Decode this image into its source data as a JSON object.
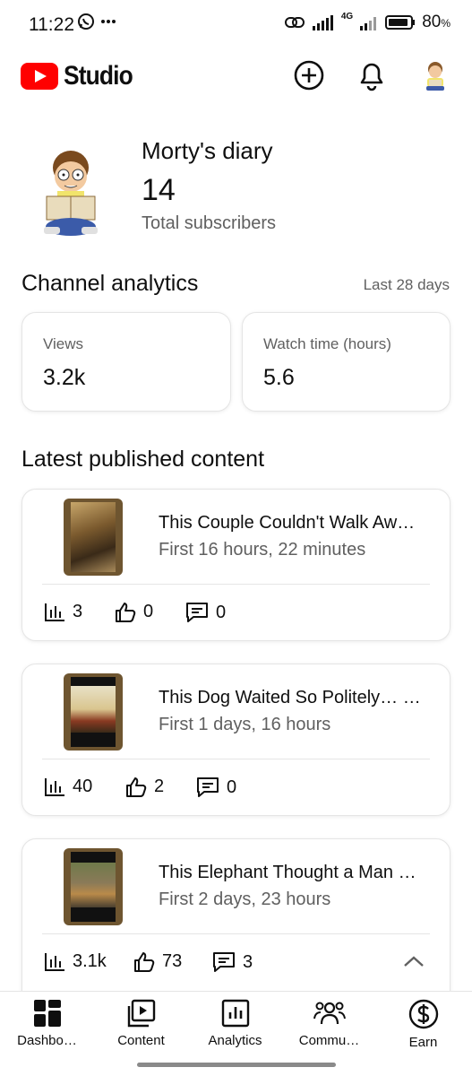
{
  "status_bar": {
    "time": "11:22",
    "network": "4G",
    "battery": "80",
    "battery_unit": "%"
  },
  "header": {
    "logo_text": "Studio",
    "brand_color": "#ff0000",
    "icons": [
      "create-icon",
      "bell-icon",
      "account-avatar"
    ]
  },
  "channel": {
    "name": "Morty's diary",
    "subscribers": "14",
    "subscribers_label": "Total subscribers"
  },
  "analytics": {
    "title": "Channel analytics",
    "period": "Last 28 days",
    "metrics": [
      {
        "label": "Views",
        "value": "3.2k"
      },
      {
        "label": "Watch time (hours)",
        "value": "5.6"
      }
    ]
  },
  "latest": {
    "title": "Latest published content",
    "videos": [
      {
        "title": "This Couple Couldn't Walk Aw…",
        "subtitle": "First 16 hours, 22 minutes",
        "views": "3",
        "likes": "0",
        "comments": "0"
      },
      {
        "title": "This Dog Waited So Politely… …",
        "subtitle": "First 1 days, 16 hours",
        "views": "40",
        "likes": "2",
        "comments": "0"
      },
      {
        "title": "This Elephant Thought a Man …",
        "subtitle": "First 2 days, 23 hours",
        "views": "3.1k",
        "likes": "73",
        "comments": "3"
      }
    ]
  },
  "nav": {
    "items": [
      {
        "label": "Dashbo…",
        "icon": "dashboard-icon"
      },
      {
        "label": "Content",
        "icon": "content-icon"
      },
      {
        "label": "Analytics",
        "icon": "analytics-icon"
      },
      {
        "label": "Commu…",
        "icon": "community-icon"
      },
      {
        "label": "Earn",
        "icon": "earn-icon"
      }
    ]
  }
}
